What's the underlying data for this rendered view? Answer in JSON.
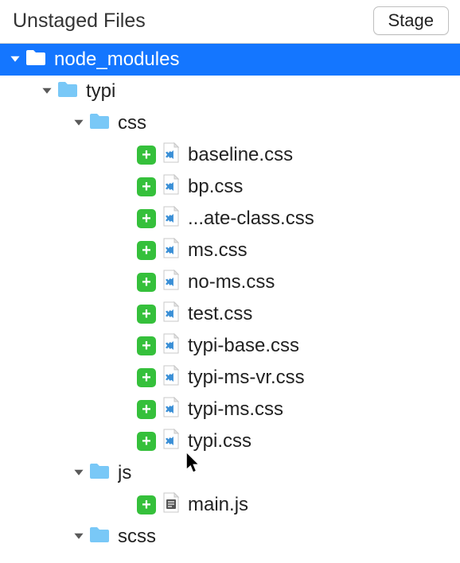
{
  "header": {
    "title": "Unstaged Files",
    "stage_button": "Stage"
  },
  "tree": {
    "root": {
      "name": "node_modules",
      "expanded": true,
      "selected": true,
      "children": [
        {
          "name": "typi",
          "type": "folder",
          "expanded": true,
          "children": [
            {
              "name": "css",
              "type": "folder",
              "expanded": true,
              "children": [
                {
                  "name": "baseline.css",
                  "type": "file",
                  "status": "added",
                  "ftype": "vscode"
                },
                {
                  "name": "bp.css",
                  "type": "file",
                  "status": "added",
                  "ftype": "vscode"
                },
                {
                  "name": "...ate-class.css",
                  "type": "file",
                  "status": "added",
                  "ftype": "vscode"
                },
                {
                  "name": "ms.css",
                  "type": "file",
                  "status": "added",
                  "ftype": "vscode"
                },
                {
                  "name": "no-ms.css",
                  "type": "file",
                  "status": "added",
                  "ftype": "vscode"
                },
                {
                  "name": "test.css",
                  "type": "file",
                  "status": "added",
                  "ftype": "vscode"
                },
                {
                  "name": "typi-base.css",
                  "type": "file",
                  "status": "added",
                  "ftype": "vscode"
                },
                {
                  "name": "typi-ms-vr.css",
                  "type": "file",
                  "status": "added",
                  "ftype": "vscode"
                },
                {
                  "name": "typi-ms.css",
                  "type": "file",
                  "status": "added",
                  "ftype": "vscode"
                },
                {
                  "name": "typi.css",
                  "type": "file",
                  "status": "added",
                  "ftype": "vscode"
                }
              ]
            },
            {
              "name": "js",
              "type": "folder",
              "expanded": true,
              "children": [
                {
                  "name": "main.js",
                  "type": "file",
                  "status": "added",
                  "ftype": "js"
                }
              ]
            },
            {
              "name": "scss",
              "type": "folder",
              "expanded": true,
              "children": []
            }
          ]
        }
      ]
    }
  },
  "colors": {
    "selection": "#1476ff",
    "added": "#35c03b",
    "folder": "#79c8f7",
    "vscode": "#3a8fd6"
  }
}
